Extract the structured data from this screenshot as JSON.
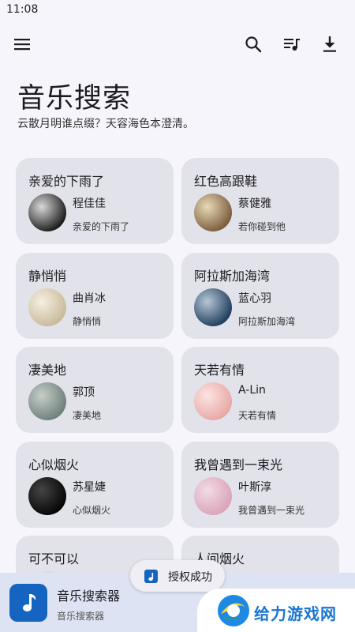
{
  "status_bar": {
    "time": "11:08"
  },
  "toolbar": {
    "menu_icon": "hamburger-menu-icon",
    "search_icon": "search-icon",
    "queue_icon": "playlist-icon",
    "download_icon": "download-icon"
  },
  "header": {
    "title": "音乐搜索",
    "subtitle": "云散月明谁点缀？天容海色本澄清。"
  },
  "cards": [
    {
      "title": "亲爱的下雨了",
      "artist": "程佳佳",
      "song": "亲爱的下雨了",
      "art_colors": [
        "#1a1a1a",
        "#d9d9d9"
      ]
    },
    {
      "title": "红色高跟鞋",
      "artist": "蔡健雅",
      "song": "若你碰到他",
      "art_colors": [
        "#7a5c3a",
        "#e8d9b8"
      ]
    },
    {
      "title": "静悄悄",
      "artist": "曲肖冰",
      "song": "静悄悄",
      "art_colors": [
        "#c9b99a",
        "#f5efe2"
      ]
    },
    {
      "title": "阿拉斯加海湾",
      "artist": "蓝心羽",
      "song": "阿拉斯加海湾",
      "art_colors": [
        "#1e3d5c",
        "#b7c7d6"
      ]
    },
    {
      "title": "凄美地",
      "artist": "郭顶",
      "song": "凄美地",
      "art_colors": [
        "#6f7f7a",
        "#c5cec9"
      ]
    },
    {
      "title": "天若有情",
      "artist": "A-Lin",
      "song": "天若有情",
      "art_colors": [
        "#e8a7a4",
        "#fbe4e2"
      ]
    },
    {
      "title": "心似烟火",
      "artist": "苏星婕",
      "song": "心似烟火",
      "art_colors": [
        "#050505",
        "#444444"
      ]
    },
    {
      "title": "我曾遇到一束光",
      "artist": "叶斯淳",
      "song": "我曾遇到一束光",
      "art_colors": [
        "#d9a3b8",
        "#f3dbe6"
      ]
    },
    {
      "title": "可不可以",
      "artist": "",
      "song": "",
      "art_colors": [
        "#cccccc",
        "#eeeeee"
      ]
    },
    {
      "title": "人间烟火",
      "artist": "",
      "song": "",
      "art_colors": [
        "#cccccc",
        "#eeeeee"
      ]
    }
  ],
  "player": {
    "title": "音乐搜索器",
    "subtitle": "音乐搜索器",
    "icon": "music-note-icon"
  },
  "toast": {
    "text": "授权成功",
    "icon": "music-note-icon"
  },
  "watermark": {
    "text": "给力游戏网"
  },
  "colors": {
    "accent": "#1565c0",
    "card_bg": "#e2e2eb",
    "background": "#f6f5fb"
  }
}
